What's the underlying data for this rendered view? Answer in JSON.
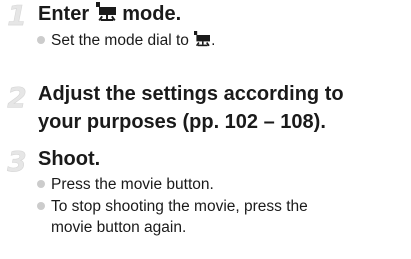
{
  "steps": [
    {
      "number": "1",
      "title_prefix": "Enter ",
      "title_suffix": " mode.",
      "title_icon": "movie-mode-icon",
      "bullets": [
        {
          "prefix": "Set the mode dial to ",
          "suffix": ".",
          "icon": "movie-mode-icon"
        }
      ]
    },
    {
      "number": "2",
      "title_line1": "Adjust the settings according to",
      "title_line2": "your purposes (pp. 102 – 108)."
    },
    {
      "number": "3",
      "title": "Shoot.",
      "bullets": [
        {
          "text": "Press the movie button."
        },
        {
          "line1": "To stop shooting the movie, press the",
          "line2": "movie button again."
        }
      ]
    }
  ],
  "colors": {
    "text": "#1a1a1a",
    "step_number": "#e6e6e6",
    "bullet_dot": "#cccccc"
  }
}
